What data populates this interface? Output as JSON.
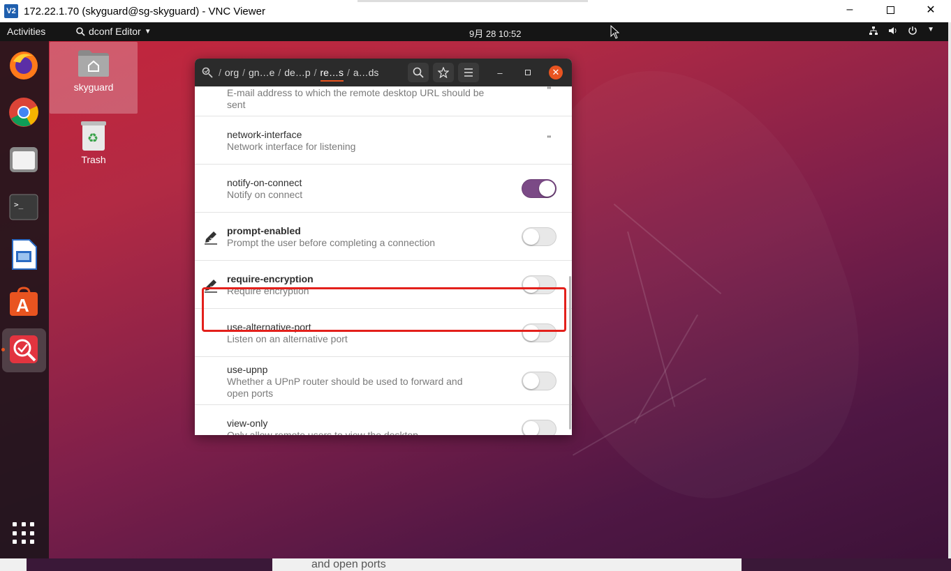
{
  "vnc": {
    "logo": "V2",
    "title": "172.22.1.70 (skyguard@sg-skyguard) - VNC Viewer",
    "controls": [
      "minimize-icon",
      "maximize-icon",
      "close-icon"
    ]
  },
  "topbar": {
    "activities": "Activities",
    "app_name": "dconf Editor",
    "clock": "9月 28  10:52"
  },
  "dock": {
    "items": [
      "firefox-icon",
      "chrome-icon",
      "files-icon",
      "terminal-icon",
      "libreoffice-writer-icon",
      "software-center-icon",
      "dconf-editor-icon"
    ],
    "active": "dconf-editor-icon"
  },
  "desktop": {
    "icons": [
      {
        "label": "skyguard",
        "icon": "home-folder-icon"
      },
      {
        "label": "Trash",
        "icon": "trash-icon"
      }
    ]
  },
  "dconf": {
    "breadcrumbs": [
      "org",
      "gn…e",
      "de…p",
      "re…s",
      "a…ds"
    ],
    "active_crumb": "re…s",
    "rows": [
      {
        "name": "",
        "desc": "E-mail address to which the remote desktop URL should be sent",
        "value": "''",
        "control": "text"
      },
      {
        "name": "network-interface",
        "desc": "Network interface for listening",
        "value": "''",
        "control": "text"
      },
      {
        "name": "notify-on-connect",
        "desc": "Notify on connect",
        "value": "on",
        "control": "toggle"
      },
      {
        "name": "prompt-enabled",
        "desc": "Prompt the user before completing a connection",
        "value": "off",
        "control": "toggle",
        "modified": true
      },
      {
        "name": "require-encryption",
        "desc": "Require encryption",
        "value": "off",
        "control": "toggle",
        "modified": true,
        "highlighted": true
      },
      {
        "name": "use-alternative-port",
        "desc": "Listen on an alternative port",
        "value": "off",
        "control": "toggle"
      },
      {
        "name": "use-upnp",
        "desc": "Whether a UPnP router should be used to forward and open ports",
        "value": "off",
        "control": "toggle"
      },
      {
        "name": "view-only",
        "desc": "Only allow remote users to view the desktop",
        "value": "off",
        "control": "toggle"
      }
    ]
  },
  "bottom_echo": "and open ports",
  "colors": {
    "accent": "#e95420",
    "toggle_on": "#7b4a86",
    "highlight": "#e3201b"
  }
}
